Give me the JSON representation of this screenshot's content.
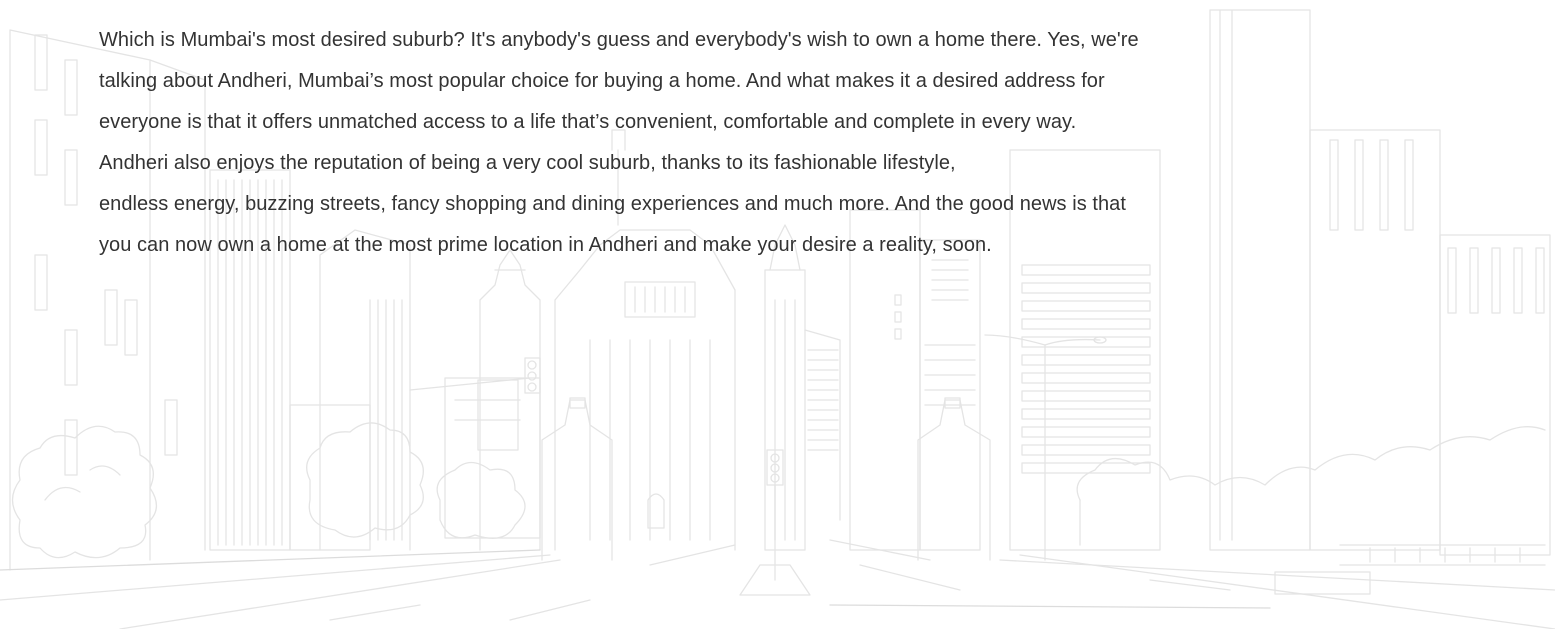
{
  "article": {
    "lines": [
      "Which is Mumbai's most desired suburb? It's anybody's guess and everybody's wish to own a home there. Yes, we're",
      "talking about Andheri, Mumbai’s most popular choice for buying a home. And what makes it a desired address for",
      "everyone is that it offers unmatched access to a life that’s convenient, comfortable and complete in every way.",
      "Andheri also enjoys the reputation of being a very cool suburb, thanks to its fashionable lifestyle,",
      "endless energy, buzzing streets, fancy shopping and dining experiences and much more. And the good news is that",
      "you can now own a home at the most prime location in Andheri and make your desire a reality, soon."
    ]
  },
  "background": {
    "illustration": "cityscape-line-illustration",
    "stroke_color": "#e4e4e4",
    "background_color": "#ffffff",
    "text_color": "#333333"
  }
}
